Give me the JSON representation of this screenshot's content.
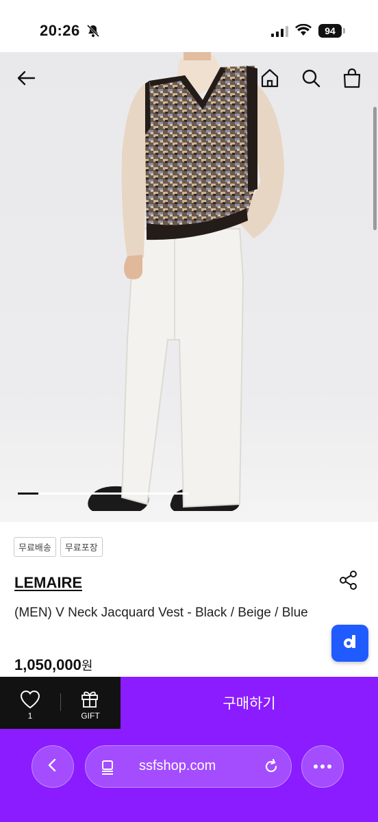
{
  "status_bar": {
    "time": "20:26",
    "battery": "94"
  },
  "hero": {
    "image_description": "model wearing jacquard knit vest over beige shirt with white trousers",
    "slide_index": 1
  },
  "tags": [
    "무료배송",
    "무료포장"
  ],
  "product": {
    "brand": "LEMAIRE",
    "name": "(MEN) V Neck Jacquard Vest - Black / Beige / Blue",
    "price": "1,050,000",
    "currency": "원"
  },
  "actions": {
    "wish_count": "1",
    "gift_label": "GIFT",
    "buy_label": "구매하기"
  },
  "browser": {
    "url": "ssfshop.com"
  },
  "colors": {
    "accent": "#8a1cff",
    "fab": "#1f5bff",
    "wish_bg": "#121212"
  }
}
